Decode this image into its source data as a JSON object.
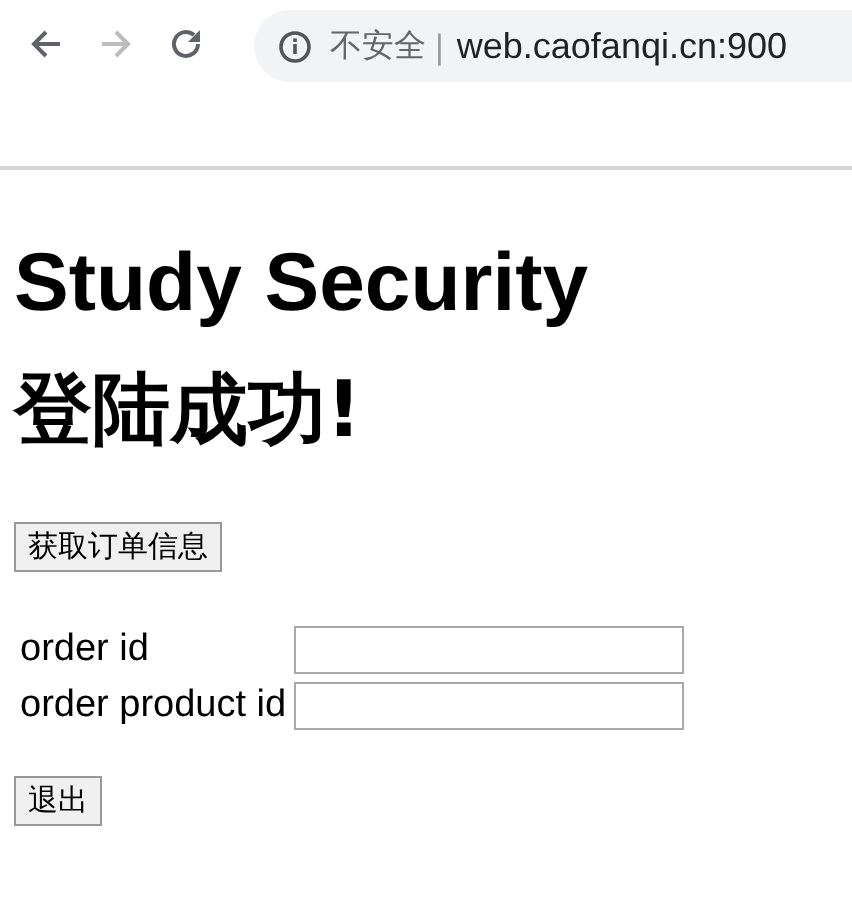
{
  "browser": {
    "nav_buttons": [
      {
        "kind": "back",
        "disabled": false
      },
      {
        "kind": "forward",
        "disabled": true
      },
      {
        "kind": "reload",
        "disabled": false
      }
    ],
    "address_bar": {
      "security_label": "不安全",
      "separator": "|",
      "url": "web.caofanqi.cn:900"
    }
  },
  "page": {
    "title": "Study Security",
    "subtitle": "登陆成功!",
    "fetch_button": "获取订单信息",
    "form_rows": [
      {
        "label": "order id"
      },
      {
        "label": "order product id"
      }
    ],
    "logout_button": "退出"
  }
}
